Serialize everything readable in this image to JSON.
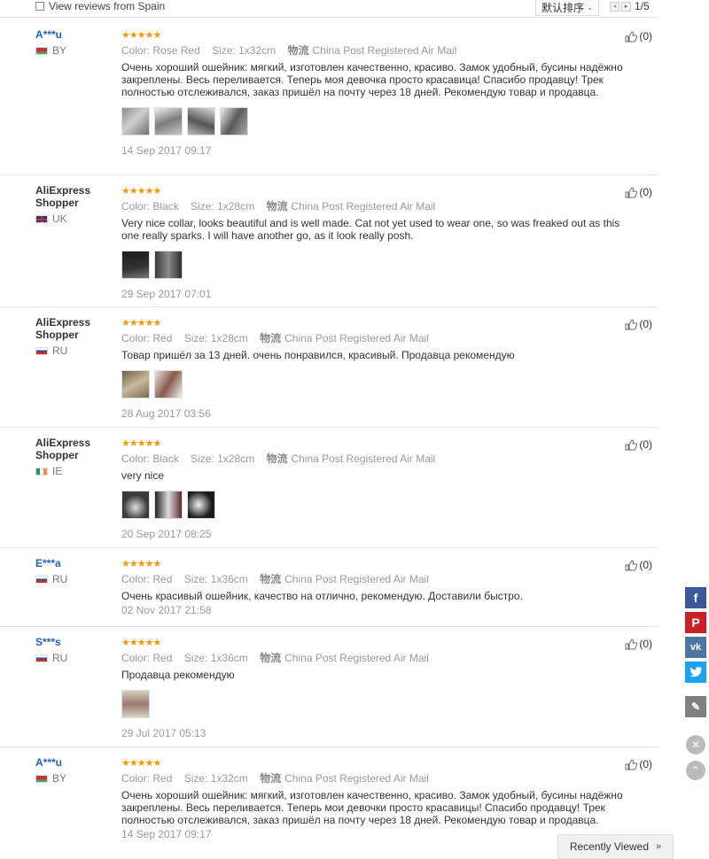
{
  "filter": {
    "label": "View reviews from Spain"
  },
  "sort": {
    "selected": "默认排序"
  },
  "pager": {
    "prev": "◂",
    "next": "▸",
    "page_text": "1/5"
  },
  "labels": {
    "color": "Color:",
    "size": "Size:",
    "ship": "物流"
  },
  "recently_viewed": {
    "label": "Recently Viewed",
    "icon": "»"
  },
  "reviews": [
    {
      "user": "A***u",
      "country": "BY",
      "stars": "★★★★★",
      "color": "Rose Red",
      "size": "1x32cm",
      "ship": "China Post Registered Air Mail",
      "text": "Очень хороший ошейник: мягкий, изготовлен качественно, красиво. Замок удобный, бусины надёжно закреплены. Весь переливается. Теперь моя девочка просто красавица! Спасибо продавцу! Трек полностью отслеживался, заказ пришёл на почту через 18 дней. Рекомендую товар и продавца.",
      "date": "14 Sep 2017 09:17",
      "helpful": "(0)"
    },
    {
      "user": "AliExpress Shopper",
      "country": "UK",
      "stars": "★★★★★",
      "color": "Black",
      "size": "1x28cm",
      "ship": "China Post Registered Air Mail",
      "text": "Very nice collar, looks beautiful and is well made. Cat not yet used to wear one, so was freaked out as this one really sparks. I will have another go, as it look really posh.",
      "date": "29 Sep 2017 07:01",
      "helpful": "(0)"
    },
    {
      "user": "AliExpress Shopper",
      "country": "RU",
      "stars": "★★★★★",
      "color": "Red",
      "size": "1x28cm",
      "ship": "China Post Registered Air Mail",
      "text": "Товар пришёл за 13 дней. очень понравился, красивый. Продавца рекомендую",
      "date": "28 Aug 2017 03:56",
      "helpful": "(0)"
    },
    {
      "user": "AliExpress Shopper",
      "country": "IE",
      "stars": "★★★★★",
      "color": "Black",
      "size": "1x28cm",
      "ship": "China Post Registered Air Mail",
      "text": "very nice",
      "date": "20 Sep 2017 08:25",
      "helpful": "(0)"
    },
    {
      "user": "E***a",
      "country": "RU",
      "stars": "★★★★★",
      "color": "Red",
      "size": "1x36cm",
      "ship": "China Post Registered Air Mail",
      "text": "Очень красивый ошейник, качество на отлично, рекомендую. Доставили быстро.",
      "date": "02 Nov 2017 21:58",
      "helpful": "(0)"
    },
    {
      "user": "S***s",
      "country": "RU",
      "stars": "★★★★★",
      "color": "Red",
      "size": "1x36cm",
      "ship": "China Post Registered Air Mail",
      "text": "Продавца рекомендую",
      "date": "29 Jul 2017 05:13",
      "helpful": "(0)"
    },
    {
      "user": "A***u",
      "country": "BY",
      "stars": "★★★★★",
      "color": "Red",
      "size": "1x32cm",
      "ship": "China Post Registered Air Mail",
      "text": "Очень хороший ошейник: мягкий, изготовлен качественно, красиво. Замок удобный, бусины надёжно закреплены. Весь переливается. Теперь мои девочки просто красавицы! Спасибо продавцу! Трек полностью отслеживался, заказ пришёл на почту через 18 дней. Рекомендую товар и продавца.",
      "date": "14 Sep 2017 09:17",
      "helpful": "(0)"
    }
  ],
  "colors": {
    "link_blue": "#2062c4",
    "star": "#f29900",
    "facebook": "#3b5998",
    "pinterest": "#cb2027",
    "vk": "#4c75a3",
    "twitter": "#1da1f2"
  },
  "icons": {
    "like": "thumbs-up-icon",
    "share": [
      "facebook-icon",
      "pinterest-icon",
      "vk-icon",
      "twitter-icon",
      "edit-icon"
    ]
  }
}
